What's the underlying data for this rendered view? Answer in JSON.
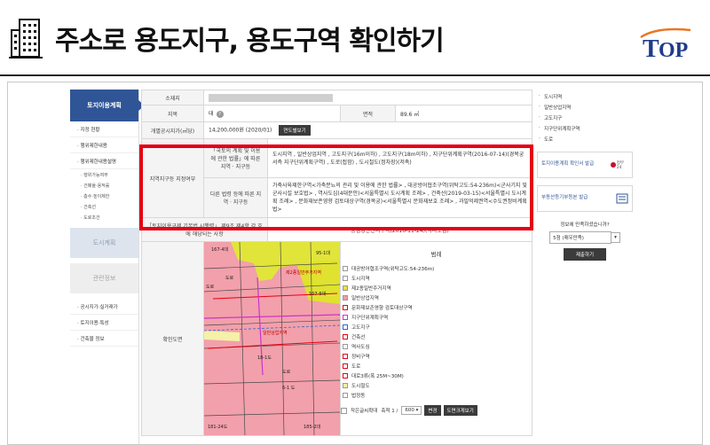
{
  "slide": {
    "title": "주소로 용도지구, 용도구역 확인하기",
    "logo_text": "TOP"
  },
  "lnb": {
    "header": "토지이용계획",
    "items": [
      {
        "label": "· 지정 현황"
      },
      {
        "label": "· 행위제한내용"
      },
      {
        "label": "· 행위제한내용설명"
      }
    ],
    "subitems": [
      {
        "label": "· 행위가능여부"
      },
      {
        "label": "· 건폐율·용적률"
      },
      {
        "label": "· 층수·높이제한"
      },
      {
        "label": "· 건축선"
      },
      {
        "label": "· 도로조건"
      }
    ],
    "box1": "도시계획",
    "box2": "관련정보",
    "bottom_items": [
      {
        "label": "· 공시지가·실거래가"
      },
      {
        "label": "· 토지이용·특성"
      },
      {
        "label": "· 건축물 정보"
      }
    ]
  },
  "info": {
    "addr_label": "소재지",
    "jimok_label": "지목",
    "jimok_value": "대",
    "area_label": "면적",
    "area_value": "89.6 ㎡",
    "price_label": "개별공시지가(㎡당)",
    "price_value": "14,200,000원 (2020/01)",
    "price_button": "연도별보기",
    "zone_label": "지역지구등 지정여부",
    "nat_label": "「국토의 계획 및 이용에 관한 법률」에 따른 지역 · 지구등",
    "nat_value": "도시지역 , 일반상업지역 , 고도지구(16m이하) , 고도지구(18m이하) , 지구단위계획구역(2016-07-14)(경복궁서측 지구단위계획구역) , 도로(접함) , 도시철도(정차장)(저촉)",
    "other_label": "다른 법령 등에 따른 지역 · 지구등",
    "other_value": "가축사육제한구역<가축분뇨의 관리 및 이용에 관한 법률> , 대공방어협조구역(위탁고도:54-236m)<군사기지 및 군사시설 보호법> , 역사도심(4대문안)<서울특별시 도시계획 조례> , 건축선(2019-03-15)<서울특별시 도시계획 조례> , 문화재보존영향 검토대상구역(경복궁)<서울특별시 문화재보호 조례> , 과밀억제권역<수도권정비계획법>",
    "enf_label": "「토지이용규제 기본법 시행령」 제9조 제4항 각 호에 해당되는 사항",
    "enf_value": "중점경관관리구역(2016-11-24)(역사도심)",
    "map_label": "확인도면"
  },
  "legend": {
    "title": "범례",
    "items": [
      {
        "label": "대공방어협조구역(위탁고도:54-236m)",
        "color": "#ffffff"
      },
      {
        "label": "도시지역",
        "color": "#ffffff"
      },
      {
        "label": "제2종일반주거지역",
        "color": "#e8e23a"
      },
      {
        "label": "일반상업지역",
        "color": "#f49aa7"
      },
      {
        "label": "문화재보존영향 검토대상구역",
        "color": "#ffffff"
      },
      {
        "label": "지구단위계획구역",
        "color": "#ffffff"
      },
      {
        "label": "고도지구",
        "color": "#ffffff"
      },
      {
        "label": "건축선",
        "color": "#ffffff"
      },
      {
        "label": "역사도심",
        "color": "#ffffff"
      },
      {
        "label": "정비구역",
        "color": "#ffffff"
      },
      {
        "label": "도로",
        "color": "#ffffff"
      },
      {
        "label": "대로3류(폭 25M~30M)",
        "color": "#ffffff"
      },
      {
        "label": "도시철도",
        "color": "#f3f0a5"
      },
      {
        "label": "법정동",
        "color": "#ffffff"
      }
    ],
    "foot_check": "작은글씨확대",
    "scale_label": "축척 1 /",
    "scale_value": "600",
    "change_button": "변경",
    "zoom_button": "도면크게보기"
  },
  "rnb": {
    "items": [
      {
        "label": "도시지역"
      },
      {
        "label": "일반상업지역"
      },
      {
        "label": "고도지구"
      },
      {
        "label": "지구단위계획구역"
      },
      {
        "label": "도로"
      }
    ],
    "card1": "토지이용계획 확인서 발급",
    "card1_seal": "정부24",
    "card2": "부동산등기부등본 발급",
    "survey_q": "정보에 만족하셨습니까?",
    "survey_value": "5점 (매우만족)",
    "survey_submit": "제출하기"
  },
  "map_labels": {
    "a": "167-4대",
    "b": "도로",
    "c": "도로",
    "d": "95-1대",
    "e": "107-5대",
    "f": "18-1도",
    "g": "181-24도",
    "h": "185-2대",
    "i": "6-1 도",
    "j": "도로",
    "k": "제2종일반주거지역",
    "l": "일반상업지역"
  }
}
